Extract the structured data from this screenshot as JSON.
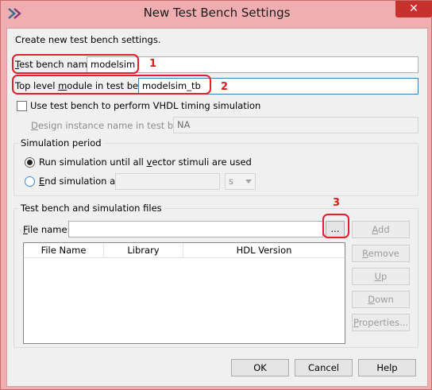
{
  "window": {
    "title": "New Test Bench Settings",
    "close_glyph": "✕",
    "icon": "quartus-app-icon"
  },
  "intro_text": "Create new test bench settings.",
  "test_bench_name": {
    "label_prefix": "T",
    "label_rest": "est bench name:",
    "value": "modelsim",
    "marker": "1"
  },
  "top_level_module": {
    "label_pre": "Top level ",
    "label_mnemonic": "m",
    "label_post": "odule in test bench:",
    "value": "modelsim_tb",
    "marker": "2"
  },
  "vhdl_timing": {
    "label": "Use test bench to perform VHDL timing simulation",
    "checked": false
  },
  "design_instance": {
    "label_mnemonic": "D",
    "label_rest": "esign instance name in test bench:",
    "value": "NA"
  },
  "simulation_period": {
    "title": "Simulation period",
    "run_option_pre": "Run simulation until all ",
    "run_option_mnemonic": "v",
    "run_option_post": "ector stimuli are used",
    "end_option_mnemonic": "E",
    "end_option_rest": "nd simulation at:",
    "end_value": "",
    "unit": "s",
    "selected": "run"
  },
  "files": {
    "title": "Test bench and simulation files",
    "file_name_mnemonic": "F",
    "file_name_rest": "ile name:",
    "file_name_value": "",
    "browse_label": "...",
    "browse_marker": "3",
    "add_mnemonic": "A",
    "add_rest": "dd",
    "remove_mnemonic": "R",
    "remove_rest": "emove",
    "up_mnemonic": "U",
    "up_rest": "p",
    "down_mnemonic": "D",
    "down_rest": "own",
    "properties_mnemonic": "P",
    "properties_rest": "roperties...",
    "columns": [
      "File Name",
      "Library",
      "HDL Version"
    ],
    "rows": []
  },
  "footer": {
    "ok": "OK",
    "cancel": "Cancel",
    "help": "Help"
  },
  "colors": {
    "title_bar": "#f0aeb1",
    "close_button": "#c7302c",
    "annotation": "#e0202a"
  }
}
